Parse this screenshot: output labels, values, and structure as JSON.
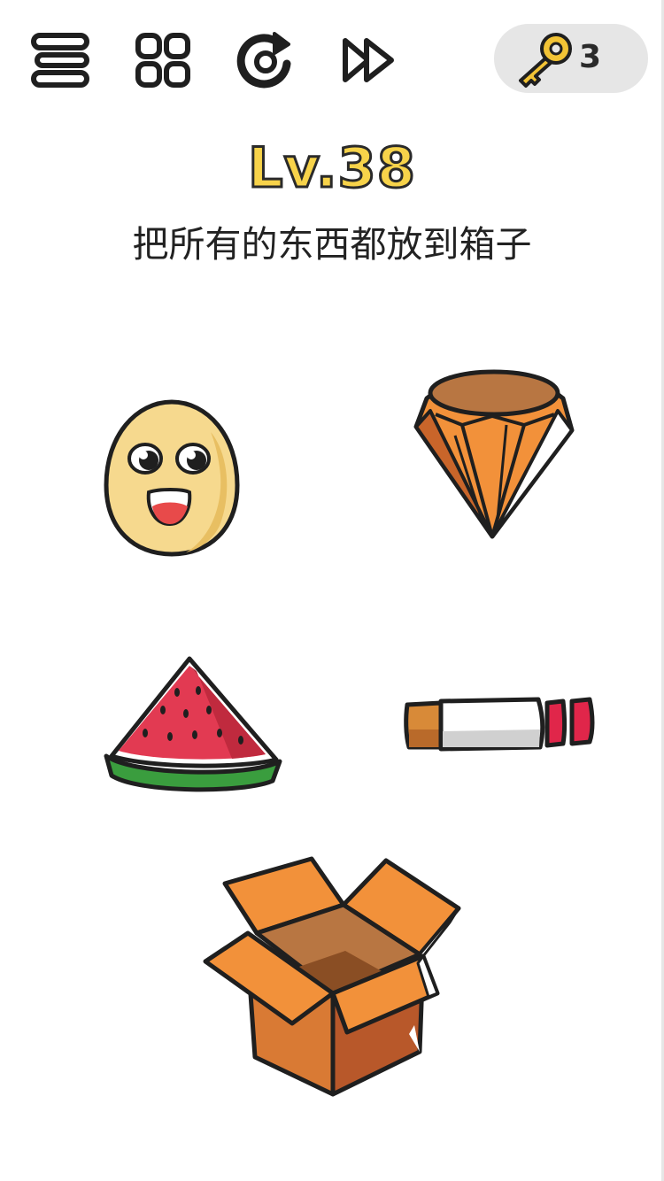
{
  "toolbar": {
    "buttons": [
      {
        "name": "menu",
        "icon": "menu-icon"
      },
      {
        "name": "levels",
        "icon": "grid-icon"
      },
      {
        "name": "restart",
        "icon": "restart-icon"
      },
      {
        "name": "skip",
        "icon": "fast-forward-icon"
      }
    ],
    "keys": {
      "icon": "key-icon",
      "count": "3"
    }
  },
  "level": {
    "title": "Lv.38"
  },
  "puzzle": {
    "instruction": "把所有的东西都放到箱子",
    "items": [
      {
        "name": "egg-face",
        "icon": "egg-face-icon"
      },
      {
        "name": "diamond",
        "icon": "diamond-icon"
      },
      {
        "name": "watermelon-slice",
        "icon": "watermelon-icon"
      },
      {
        "name": "lipstick",
        "icon": "lipstick-icon"
      }
    ],
    "target": {
      "name": "cardboard-box",
      "icon": "open-box-icon"
    }
  },
  "colors": {
    "level_fill": "#f7d34a",
    "outline": "#2a2a2a",
    "key_pill_bg": "#e6e6e6",
    "key_gold": "#f2c335",
    "egg": "#f6d98e",
    "diamond_orange": "#f2913a",
    "watermelon_red": "#e23a52",
    "watermelon_green": "#3a9d3e",
    "lipstick_red": "#e0264a",
    "box_orange": "#f2913a",
    "box_brown": "#b8582a"
  }
}
